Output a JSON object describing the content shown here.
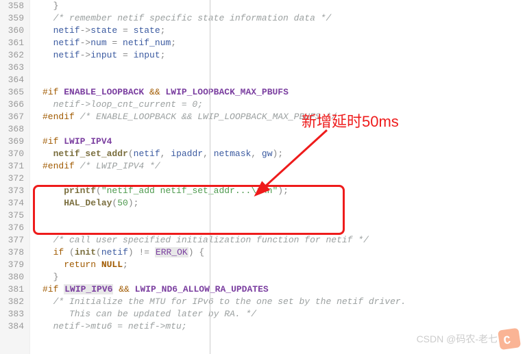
{
  "annotation_text": "新增延时50ms",
  "watermark": "CSDN @码农-老七",
  "lines": [
    {
      "num": "358",
      "tokens": [
        {
          "cls": "punc",
          "txt": "  }"
        }
      ]
    },
    {
      "num": "359",
      "tokens": [
        {
          "cls": "comment",
          "txt": "  /* remember netif specific state information data */"
        }
      ]
    },
    {
      "num": "360",
      "tokens": [
        {
          "cls": "ident",
          "txt": "  netif"
        },
        {
          "cls": "punc",
          "txt": "->"
        },
        {
          "cls": "ident",
          "txt": "state"
        },
        {
          "cls": "punc",
          "txt": " = "
        },
        {
          "cls": "ident",
          "txt": "state"
        },
        {
          "cls": "punc",
          "txt": ";"
        }
      ]
    },
    {
      "num": "361",
      "tokens": [
        {
          "cls": "ident",
          "txt": "  netif"
        },
        {
          "cls": "punc",
          "txt": "->"
        },
        {
          "cls": "ident",
          "txt": "num"
        },
        {
          "cls": "punc",
          "txt": " = "
        },
        {
          "cls": "ident",
          "txt": "netif_num"
        },
        {
          "cls": "punc",
          "txt": ";"
        }
      ]
    },
    {
      "num": "362",
      "tokens": [
        {
          "cls": "ident",
          "txt": "  netif"
        },
        {
          "cls": "punc",
          "txt": "->"
        },
        {
          "cls": "ident",
          "txt": "input"
        },
        {
          "cls": "punc",
          "txt": " = "
        },
        {
          "cls": "ident",
          "txt": "input"
        },
        {
          "cls": "punc",
          "txt": ";"
        }
      ]
    },
    {
      "num": "363",
      "tokens": []
    },
    {
      "num": "364",
      "tokens": []
    },
    {
      "num": "365",
      "tokens": [
        {
          "cls": "preproc",
          "txt": "#if "
        },
        {
          "cls": "macro",
          "txt": "ENABLE_LOOPBACK"
        },
        {
          "cls": "preproc",
          "txt": " && "
        },
        {
          "cls": "macro",
          "txt": "LWIP_LOOPBACK_MAX_PBUFS"
        }
      ]
    },
    {
      "num": "366",
      "tokens": [
        {
          "cls": "comment",
          "txt": "  netif->loop_cnt_current = 0;"
        }
      ]
    },
    {
      "num": "367",
      "tokens": [
        {
          "cls": "preproc",
          "txt": "#endif "
        },
        {
          "cls": "comment",
          "txt": "/* ENABLE_LOOPBACK && LWIP_LOOPBACK_MAX_PBUFS */"
        }
      ]
    },
    {
      "num": "368",
      "tokens": []
    },
    {
      "num": "369",
      "tokens": [
        {
          "cls": "preproc",
          "txt": "#if "
        },
        {
          "cls": "macro",
          "txt": "LWIP_IPV4"
        }
      ]
    },
    {
      "num": "370",
      "tokens": [
        {
          "cls": "func",
          "txt": "  netif_set_addr"
        },
        {
          "cls": "punc",
          "txt": "("
        },
        {
          "cls": "ident",
          "txt": "netif"
        },
        {
          "cls": "punc",
          "txt": ", "
        },
        {
          "cls": "ident",
          "txt": "ipaddr"
        },
        {
          "cls": "punc",
          "txt": ", "
        },
        {
          "cls": "ident",
          "txt": "netmask"
        },
        {
          "cls": "punc",
          "txt": ", "
        },
        {
          "cls": "ident",
          "txt": "gw"
        },
        {
          "cls": "punc",
          "txt": ");"
        }
      ]
    },
    {
      "num": "371",
      "tokens": [
        {
          "cls": "preproc",
          "txt": "#endif "
        },
        {
          "cls": "comment",
          "txt": "/* LWIP_IPV4 */"
        }
      ]
    },
    {
      "num": "372",
      "tokens": []
    },
    {
      "num": "373",
      "tokens": [
        {
          "cls": "func",
          "txt": "    printf"
        },
        {
          "cls": "punc",
          "txt": "("
        },
        {
          "cls": "string",
          "txt": "\"netif_add netif_set_addr...\\r\\n\""
        },
        {
          "cls": "punc",
          "txt": ");"
        }
      ]
    },
    {
      "num": "374",
      "tokens": [
        {
          "cls": "func",
          "txt": "    HAL_Delay"
        },
        {
          "cls": "punc",
          "txt": "("
        },
        {
          "cls": "num",
          "txt": "50"
        },
        {
          "cls": "punc",
          "txt": ");"
        }
      ]
    },
    {
      "num": "375",
      "tokens": []
    },
    {
      "num": "376",
      "tokens": []
    },
    {
      "num": "377",
      "tokens": [
        {
          "cls": "comment",
          "txt": "  /* call user specified initialization function for netif */"
        }
      ]
    },
    {
      "num": "378",
      "tokens": [
        {
          "cls": "keyword",
          "txt": "  if "
        },
        {
          "cls": "punc",
          "txt": "("
        },
        {
          "cls": "func",
          "txt": "init"
        },
        {
          "cls": "punc",
          "txt": "("
        },
        {
          "cls": "ident",
          "txt": "netif"
        },
        {
          "cls": "punc",
          "txt": ")"
        },
        {
          "cls": "punc",
          "txt": " != "
        },
        {
          "cls": "errconst hl-bg",
          "txt": "ERR_OK"
        },
        {
          "cls": "punc",
          "txt": ") {"
        }
      ]
    },
    {
      "num": "379",
      "tokens": [
        {
          "cls": "keyword",
          "txt": "    return "
        },
        {
          "cls": "null",
          "txt": "NULL"
        },
        {
          "cls": "punc",
          "txt": ";"
        }
      ]
    },
    {
      "num": "380",
      "tokens": [
        {
          "cls": "punc",
          "txt": "  }"
        }
      ]
    },
    {
      "num": "381",
      "tokens": [
        {
          "cls": "preproc",
          "txt": "#if "
        },
        {
          "cls": "macro hl-bg",
          "txt": "LWIP_IPV6"
        },
        {
          "cls": "preproc",
          "txt": " && "
        },
        {
          "cls": "macro",
          "txt": "LWIP_ND6_ALLOW_RA_UPDATES"
        }
      ]
    },
    {
      "num": "382",
      "tokens": [
        {
          "cls": "comment",
          "txt": "  /* Initialize the MTU for IPv6 to the one set by the netif driver."
        }
      ]
    },
    {
      "num": "383",
      "tokens": [
        {
          "cls": "comment",
          "txt": "     This can be updated later by RA. */"
        }
      ]
    },
    {
      "num": "384",
      "tokens": [
        {
          "cls": "comment",
          "txt": "  netif->mtu6 = netif->mtu;"
        }
      ]
    }
  ]
}
